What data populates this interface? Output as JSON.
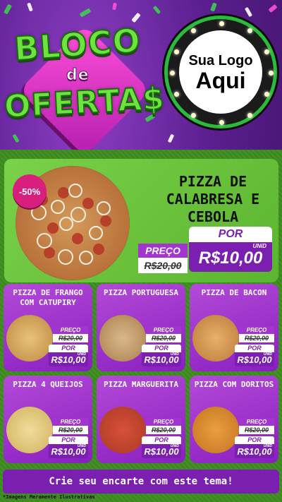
{
  "header": {
    "title_line1": "BLOCO",
    "title_line2": "de",
    "title_line3": "OFERTA$",
    "logo_line1": "Sua Logo",
    "logo_line2": "Aqui"
  },
  "hero": {
    "discount": "-50%",
    "name": "PIZZA DE CALABRESA E CEBOLA",
    "preco_label": "PREÇO",
    "old_price": "R$20,00",
    "por_label": "POR",
    "unid_label": "UNID",
    "new_price": "R$10,00"
  },
  "products": [
    {
      "name": "PIZZA DE FRANGO COM CATUPIRY",
      "preco_label": "PREÇO",
      "old_price": "R$20,00",
      "por_label": "POR",
      "unid_label": "UNID",
      "new_price": "R$10,00"
    },
    {
      "name": "PIZZA PORTUGUESA",
      "preco_label": "PREÇO",
      "old_price": "R$20,00",
      "por_label": "POR",
      "unid_label": "UNID",
      "new_price": "R$10,00"
    },
    {
      "name": "PIZZA DE BACON",
      "preco_label": "PREÇO",
      "old_price": "R$20,00",
      "por_label": "POR",
      "unid_label": "UNID",
      "new_price": "R$10,00"
    },
    {
      "name": "PIZZA 4 QUEIJOS",
      "preco_label": "PREÇO",
      "old_price": "R$20,00",
      "por_label": "POR",
      "unid_label": "UNID",
      "new_price": "R$10,00"
    },
    {
      "name": "PIZZA MARGUERITA",
      "preco_label": "PREÇO",
      "old_price": "R$20,00",
      "por_label": "POR",
      "unid_label": "UNID",
      "new_price": "R$10,00"
    },
    {
      "name": "PIZZA COM DORITOS",
      "preco_label": "PREÇO",
      "old_price": "R$20,00",
      "por_label": "POR",
      "unid_label": "UNID",
      "new_price": "R$10,00"
    }
  ],
  "footer": {
    "cta": "Crie seu encarte com este tema!",
    "disclaimer": "*Imagens Meramente Ilustrativas"
  },
  "colors": {
    "purple": "#7a1fb0",
    "green": "#6ee33f",
    "pink": "#d81f7e"
  }
}
